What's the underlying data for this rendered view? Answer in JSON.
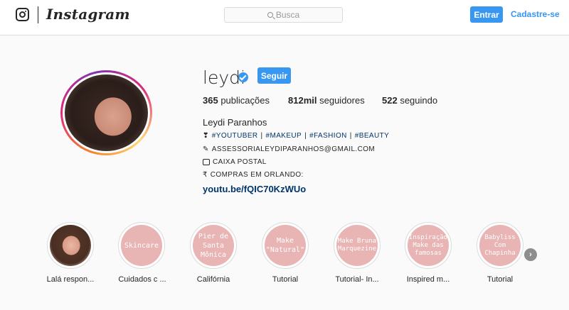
{
  "header": {
    "logo": "Instagram",
    "search_placeholder": "Busca",
    "login_label": "Entrar",
    "signup_label": "Cadastre-se"
  },
  "profile": {
    "username": "leydi",
    "follow_label": "Seguir",
    "posts_count": "365",
    "posts_label": "publicações",
    "followers_count": "812mil",
    "followers_label": "seguidores",
    "following_count": "522",
    "following_label": "seguindo",
    "full_name": "Leydi Paranhos",
    "bio_tags": [
      "#YOUTUBER",
      "#MAKEUP",
      "#FASHION",
      "#BEAUTY"
    ],
    "bio_email": "ASSESSORIALEYDIPARANHOS@GMAIL.COM",
    "bio_postal": "CAIXA POSTAL",
    "bio_shopping": "COMPRAS EM ORLANDO:",
    "link": "youtu.be/fQIC70KzWUo",
    "verified": true
  },
  "highlights": [
    {
      "label": "Lalá respon...",
      "cover_text": "",
      "photo": true
    },
    {
      "label": "Cuidados c ...",
      "cover_text": "Skincare"
    },
    {
      "label": "Califórnia",
      "cover_text": "Pier de Santa Mônica"
    },
    {
      "label": "Tutorial",
      "cover_text": "Make \"Natural\""
    },
    {
      "label": "Tutorial- In...",
      "cover_text": "Make Bruna Marquezine"
    },
    {
      "label": "Inspired m...",
      "cover_text": "Inspiração Make das famosas"
    },
    {
      "label": "Tutorial",
      "cover_text": "Babyliss Com Chapinha"
    }
  ],
  "colors": {
    "accent": "#3897f0",
    "link": "#003569",
    "highlight_fill": "#e8b4b4"
  }
}
